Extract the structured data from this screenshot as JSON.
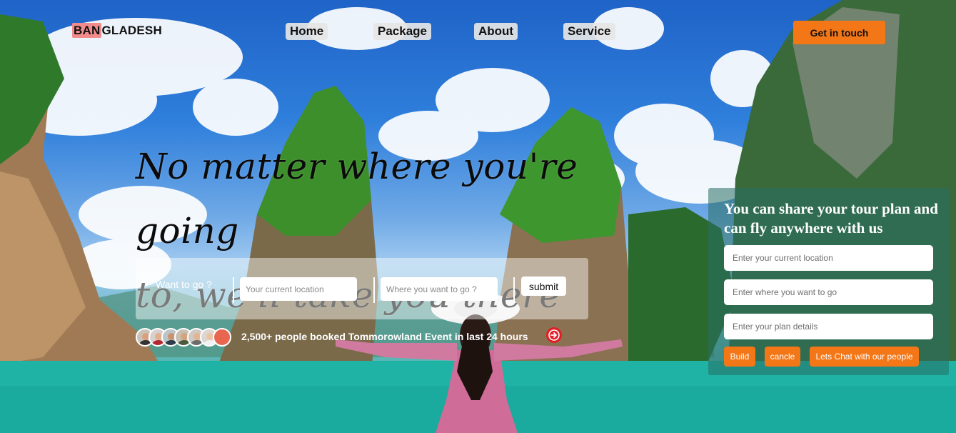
{
  "nav": {
    "logo_highlight": "BAN",
    "logo_rest": "GLADESH",
    "links": [
      "Home",
      "Package",
      "About",
      "Service"
    ],
    "cta_label": "Get in touch"
  },
  "hero": {
    "line1": "No matter where you're going",
    "line2": "to, we'll take you there"
  },
  "search": {
    "label": "Want to go ?",
    "current_placeholder": "Your current location",
    "destination_placeholder": "Where you want to go ?",
    "submit_label": "submit"
  },
  "social": {
    "avatars": [
      "avatar-1",
      "avatar-2",
      "avatar-3",
      "avatar-4",
      "avatar-5",
      "avatar-6",
      "avatar-7"
    ],
    "text": "2,500+ people booked Tommorowland Event in last 24 hours",
    "arrow_icon": "arrow-right-circle-icon"
  },
  "panel": {
    "title": "You can share your tour plan and can fly anywhere with us",
    "location_placeholder": "Enter your current location",
    "destination_placeholder": "Enter where you want to go",
    "details_placeholder": "Enter your plan details",
    "build_label": "Build",
    "cancel_label": "cancle",
    "chat_label": "Lets Chat with our people"
  },
  "colors": {
    "accent": "#f37617",
    "logo_highlight": "#f28b8b",
    "arrow_button": "#e21f26",
    "panel_bg": "rgba(40,110,100,0.55)"
  }
}
